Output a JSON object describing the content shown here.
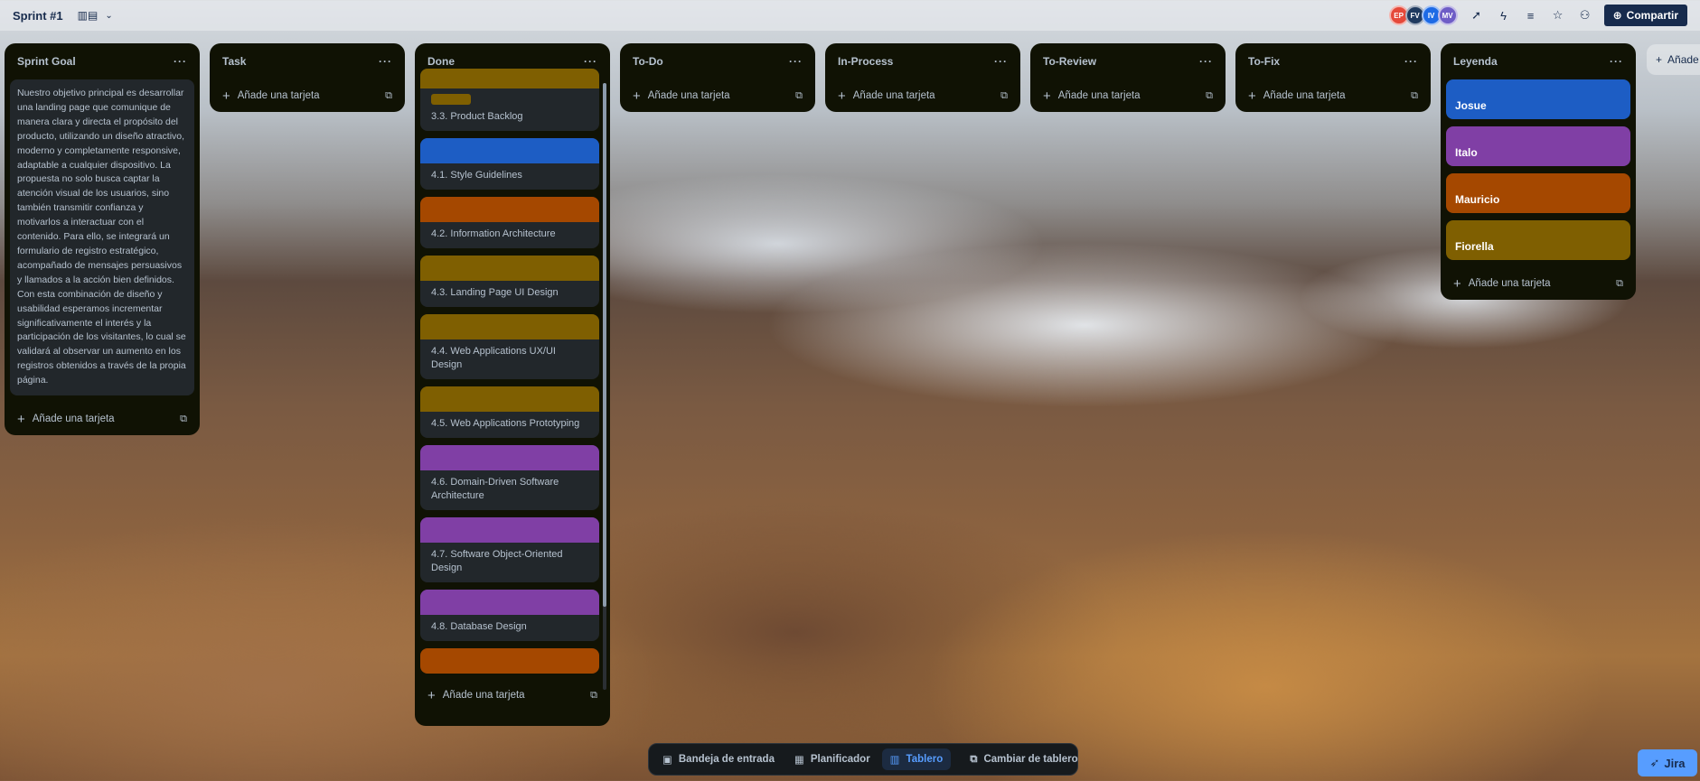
{
  "board": {
    "title": "Sprint #1",
    "view_icon": "board-view-icon",
    "share_label": "Compartir",
    "members": [
      {
        "initials": "EP",
        "color": "#e5493a"
      },
      {
        "initials": "FV",
        "color": "#1f3a5f"
      },
      {
        "initials": "IV",
        "color": "#1d6ae5"
      },
      {
        "initials": "MV",
        "color": "#6e5dc6"
      }
    ],
    "add_list_label": "Añade"
  },
  "add_card_label": "Añade una tarjeta",
  "lists": {
    "sprint_goal": {
      "title": "Sprint Goal",
      "text": "Nuestro objetivo principal es desarrollar una landing page que comunique de manera clara y directa el propósito del producto, utilizando un diseño atractivo, moderno y completamente responsive, adaptable a cualquier dispositivo. La propuesta no solo busca captar la atención visual de los usuarios, sino también transmitir confianza y motivarlos a interactuar con el contenido. Para ello, se integrará un formulario de registro estratégico, acompañado de mensajes persuasivos y llamados a la acción bien definidos. Con esta combinación de diseño y usabilidad esperamos incrementar significativamente el interés y la participación de los visitantes, lo cual se validará al observar un aumento en los registros obtenidos a través de la propia página."
    },
    "task": {
      "title": "Task"
    },
    "done": {
      "title": "Done",
      "cards": [
        {
          "title": "3.3. Product Backlog",
          "cover": "#7f5f01"
        },
        {
          "title": "4.1. Style Guidelines",
          "cover": "#1d5dc4"
        },
        {
          "title": "4.2. Information Architecture",
          "cover": "#a54800"
        },
        {
          "title": "4.3. Landing Page UI Design",
          "cover": "#7f5f01"
        },
        {
          "title": "4.4. Web Applications UX/UI Design",
          "cover": "#7f5f01"
        },
        {
          "title": "4.5. Web Applications Prototyping",
          "cover": "#7f5f01"
        },
        {
          "title": "4.6. Domain-Driven Software Architecture",
          "cover": "#803fa5"
        },
        {
          "title": "4.7. Software Object-Oriented Design",
          "cover": "#803fa5"
        },
        {
          "title": "4.8. Database Design",
          "cover": "#803fa5"
        }
      ]
    },
    "todo": {
      "title": "To-Do"
    },
    "in_process": {
      "title": "In-Process"
    },
    "to_review": {
      "title": "To-Review"
    },
    "to_fix": {
      "title": "To-Fix"
    },
    "legend": {
      "title": "Leyenda",
      "cards": [
        {
          "name": "Josue",
          "color": "#1d5dc4"
        },
        {
          "name": "Italo",
          "color": "#803fa5"
        },
        {
          "name": "Mauricio",
          "color": "#a54800"
        },
        {
          "name": "Fiorella",
          "color": "#7f5f01"
        }
      ]
    }
  },
  "nav": {
    "inbox": "Bandeja de entrada",
    "planner": "Planificador",
    "board": "Tablero",
    "switch": "Cambiar de tablero"
  },
  "jira_label": "Jira"
}
